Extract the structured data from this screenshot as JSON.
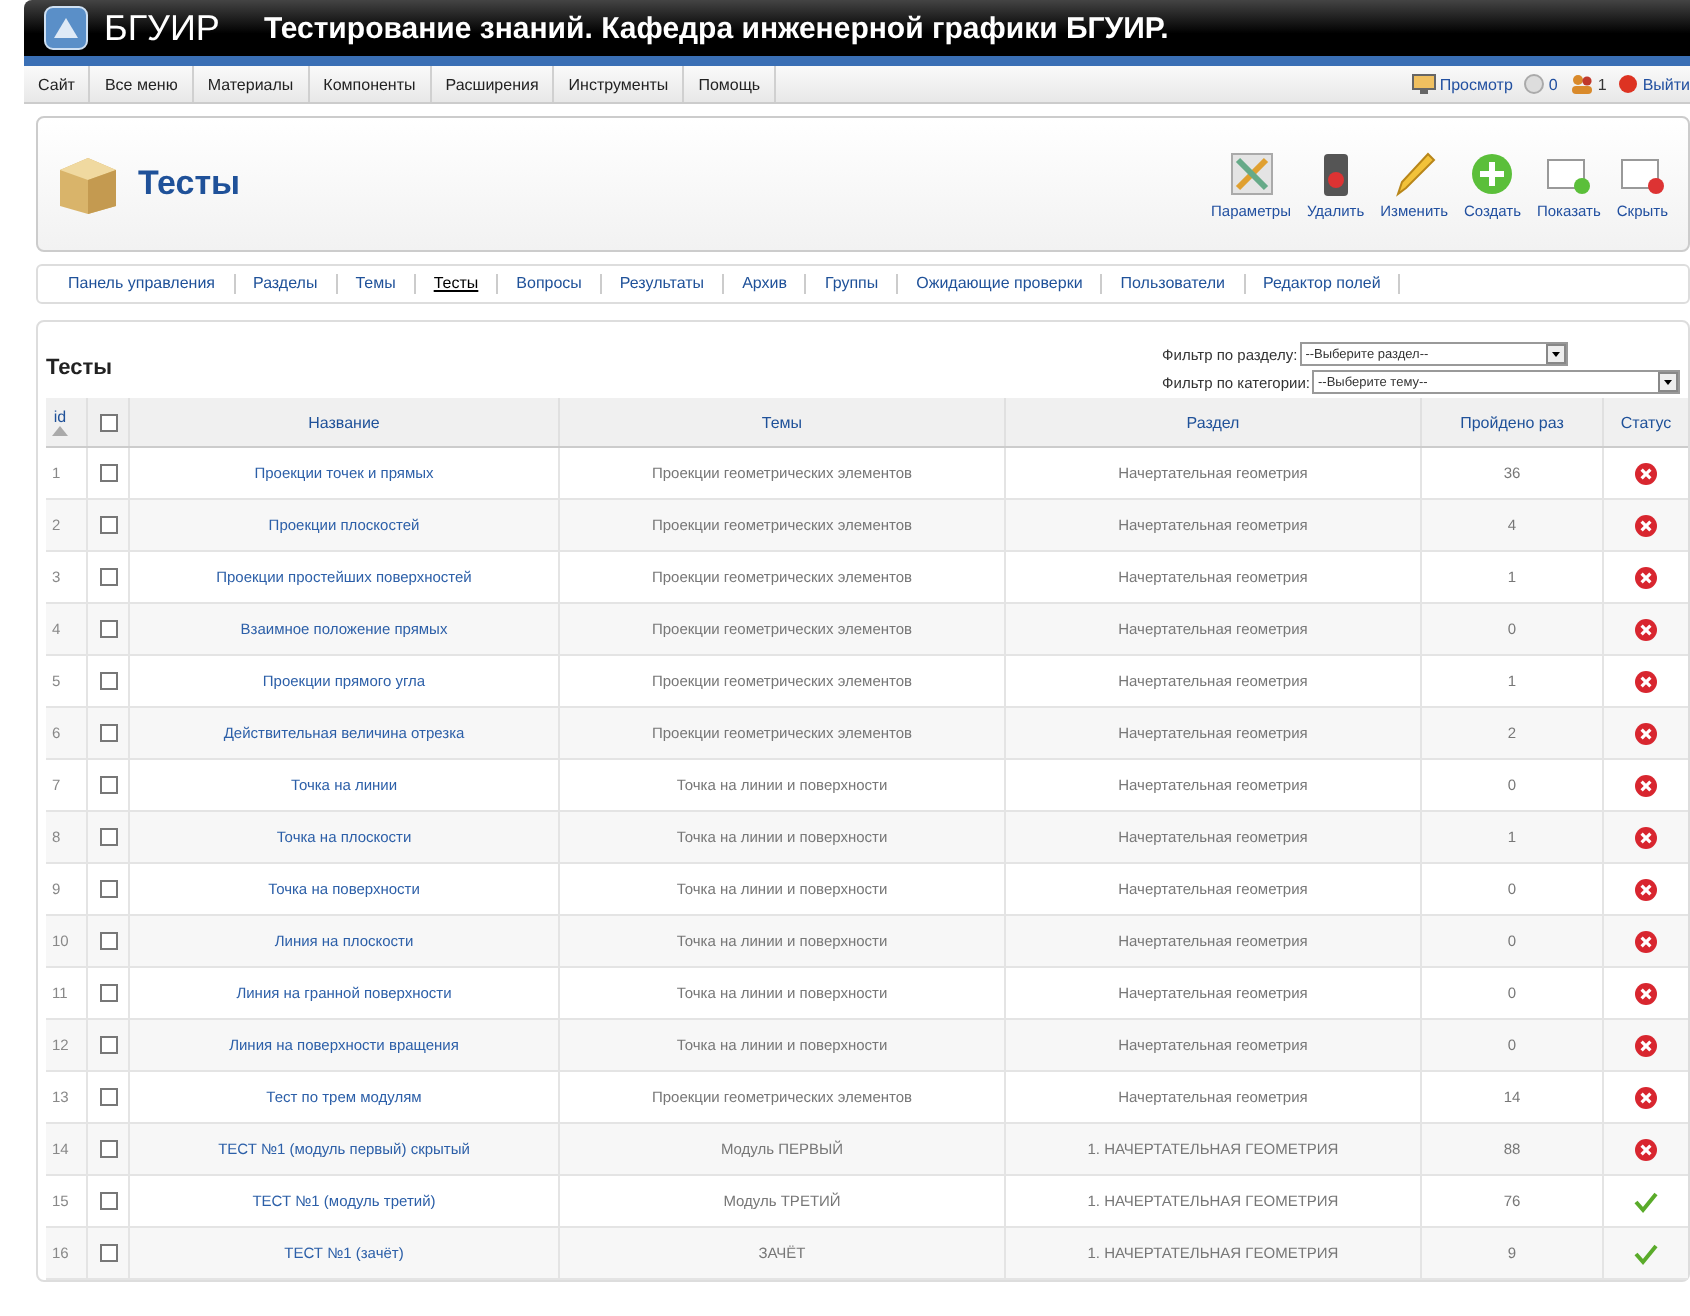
{
  "header": {
    "logo": "БГУИР",
    "title": "Тестирование знаний. Кафедра инженерной графики БГУИР."
  },
  "menu": [
    "Сайт",
    "Все меню",
    "Материалы",
    "Компоненты",
    "Расширения",
    "Инструменты",
    "Помощь"
  ],
  "status": {
    "preview": "Просмотр",
    "messages": "0",
    "users": "1",
    "logout": "Выйти"
  },
  "toolbar": {
    "title": "Тесты",
    "buttons": [
      {
        "kind": "params",
        "label": "Параметры"
      },
      {
        "kind": "delete",
        "label": "Удалить"
      },
      {
        "kind": "edit",
        "label": "Изменить"
      },
      {
        "kind": "new",
        "label": "Создать"
      },
      {
        "kind": "publish",
        "label": "Показать"
      },
      {
        "kind": "unpublish",
        "label": "Скрыть"
      }
    ]
  },
  "submenu": [
    {
      "label": "Панель управления",
      "selected": false
    },
    {
      "label": "Разделы",
      "selected": false
    },
    {
      "label": "Темы",
      "selected": false
    },
    {
      "label": "Тесты",
      "selected": true
    },
    {
      "label": "Вопросы",
      "selected": false
    },
    {
      "label": "Результаты",
      "selected": false
    },
    {
      "label": "Архив",
      "selected": false
    },
    {
      "label": "Группы",
      "selected": false
    },
    {
      "label": "Ожидающие проверки",
      "selected": false
    },
    {
      "label": "Пользователи",
      "selected": false
    },
    {
      "label": "Редактор полей",
      "selected": false
    }
  ],
  "list": {
    "title": "Тесты",
    "filters": [
      {
        "label": "Фильтр по разделу:",
        "value": "--Выберите раздел--"
      },
      {
        "label": "Фильтр по категории:",
        "value": "--Выберите тему--"
      }
    ],
    "all_checked": false,
    "columns": [
      "id",
      "Название",
      "Темы",
      "Раздел",
      "Пройдено раз",
      "Статус"
    ],
    "rows": [
      {
        "id": "1",
        "name": "Проекции точек и прямых",
        "topic": "Проекции геометрических элементов",
        "section": "Начертательная геометрия",
        "passed": "36",
        "checked": false,
        "published": false
      },
      {
        "id": "2",
        "name": "Проекции плоскостей",
        "topic": "Проекции геометрических элементов",
        "section": "Начертательная геометрия",
        "passed": "4",
        "checked": false,
        "published": false
      },
      {
        "id": "3",
        "name": "Проекции простейших поверхностей",
        "topic": "Проекции геометрических элементов",
        "section": "Начертательная геометрия",
        "passed": "1",
        "checked": false,
        "published": false
      },
      {
        "id": "4",
        "name": "Взаимное положение прямых",
        "topic": "Проекции геометрических элементов",
        "section": "Начертательная геометрия",
        "passed": "0",
        "checked": false,
        "published": false
      },
      {
        "id": "5",
        "name": "Проекции прямого угла",
        "topic": "Проекции геометрических элементов",
        "section": "Начертательная геометрия",
        "passed": "1",
        "checked": false,
        "published": false
      },
      {
        "id": "6",
        "name": "Действительная величина отрезка",
        "topic": "Проекции геометрических элементов",
        "section": "Начертательная геометрия",
        "passed": "2",
        "checked": false,
        "published": false
      },
      {
        "id": "7",
        "name": "Точка на линии",
        "topic": "Точка на линии и поверхности",
        "section": "Начертательная геометрия",
        "passed": "0",
        "checked": false,
        "published": false
      },
      {
        "id": "8",
        "name": "Точка на плоскости",
        "topic": "Точка на линии и поверхности",
        "section": "Начертательная геометрия",
        "passed": "1",
        "checked": false,
        "published": false
      },
      {
        "id": "9",
        "name": "Точка на поверхности",
        "topic": "Точка на линии и поверхности",
        "section": "Начертательная геометрия",
        "passed": "0",
        "checked": false,
        "published": false
      },
      {
        "id": "10",
        "name": "Линия на плоскости",
        "topic": "Точка на линии и поверхности",
        "section": "Начертательная геометрия",
        "passed": "0",
        "checked": false,
        "published": false
      },
      {
        "id": "11",
        "name": "Линия на гранной поверхности",
        "topic": "Точка на линии и поверхности",
        "section": "Начертательная геометрия",
        "passed": "0",
        "checked": false,
        "published": false
      },
      {
        "id": "12",
        "name": "Линия на поверхности вращения",
        "topic": "Точка на линии и поверхности",
        "section": "Начертательная геометрия",
        "passed": "0",
        "checked": false,
        "published": false
      },
      {
        "id": "13",
        "name": "Тест по трем модулям",
        "topic": "Проекции геометрических элементов",
        "section": "Начертательная геометрия",
        "passed": "14",
        "checked": false,
        "published": false
      },
      {
        "id": "14",
        "name": "ТЕСТ №1 (модуль первый) скрытый",
        "topic": "Модуль ПЕРВЫЙ",
        "section": "1. НАЧЕРТАТЕЛЬНАЯ ГЕОМЕТРИЯ",
        "passed": "88",
        "checked": false,
        "published": false
      },
      {
        "id": "15",
        "name": "ТЕСТ №1 (модуль третий)",
        "topic": "Модуль ТРЕТИЙ",
        "section": "1. НАЧЕРТАТЕЛЬНАЯ ГЕОМЕТРИЯ",
        "passed": "76",
        "checked": false,
        "published": true
      },
      {
        "id": "16",
        "name": "ТЕСТ №1 (зачёт)",
        "topic": "ЗАЧЁТ",
        "section": "1. НАЧЕРТАТЕЛЬНАЯ ГЕОМЕТРИЯ",
        "passed": "9",
        "checked": false,
        "published": true
      }
    ]
  }
}
